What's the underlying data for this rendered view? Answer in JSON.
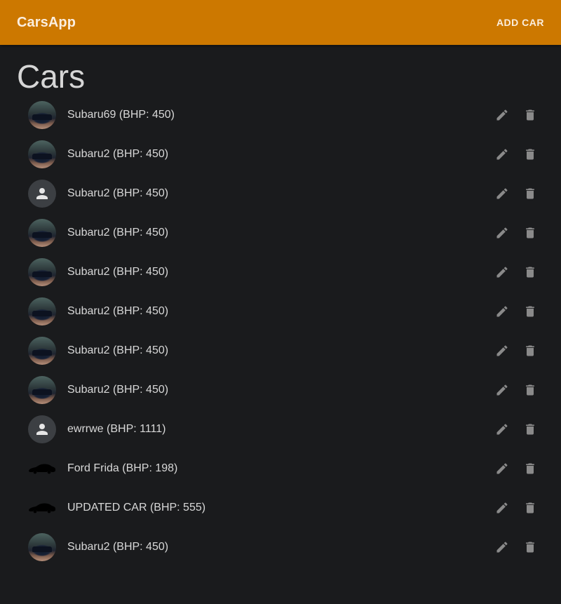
{
  "appbar": {
    "brand": "CarsApp",
    "add_car_label": "ADD CAR",
    "color": "#cc7800"
  },
  "page": {
    "title": "Cars"
  },
  "cars": [
    {
      "label": "Subaru69 (BHP: 450)",
      "avatar": "car-photo"
    },
    {
      "label": "Subaru2 (BHP: 450)",
      "avatar": "car-photo"
    },
    {
      "label": "Subaru2 (BHP: 450)",
      "avatar": "person-icon"
    },
    {
      "label": "Subaru2 (BHP: 450)",
      "avatar": "car-photo"
    },
    {
      "label": "Subaru2 (BHP: 450)",
      "avatar": "car-photo"
    },
    {
      "label": "Subaru2 (BHP: 450)",
      "avatar": "car-photo"
    },
    {
      "label": "Subaru2 (BHP: 450)",
      "avatar": "car-photo"
    },
    {
      "label": "Subaru2 (BHP: 450)",
      "avatar": "car-photo"
    },
    {
      "label": "ewrrwe (BHP: 1111)",
      "avatar": "person-icon"
    },
    {
      "label": "Ford Frida (BHP: 198)",
      "avatar": "car-silhouette"
    },
    {
      "label": "UPDATED CAR (BHP: 555)",
      "avatar": "car-silhouette"
    },
    {
      "label": "Subaru2 (BHP: 450)",
      "avatar": "car-photo"
    }
  ],
  "row_actions": [
    "edit-icon",
    "delete-icon"
  ]
}
